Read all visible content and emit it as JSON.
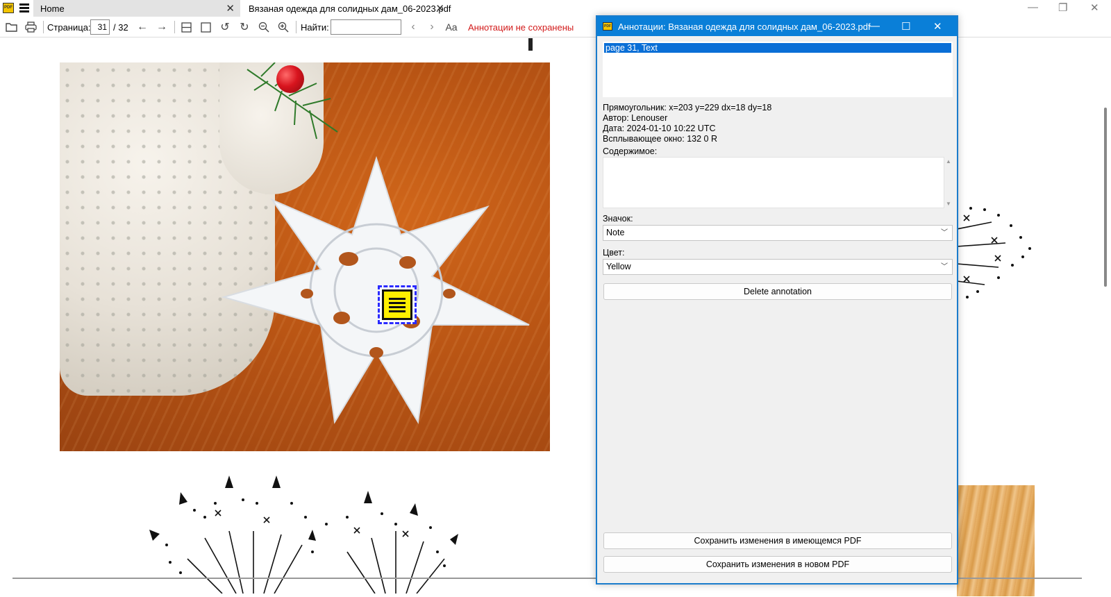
{
  "app": {
    "logo_text": "PDF",
    "tabs": [
      {
        "label": "Home"
      },
      {
        "label": "Вязаная одежда для солидных дам_06-2023.pdf"
      }
    ]
  },
  "toolbar": {
    "page_label": "Страница:",
    "current_page": "31",
    "total_pages": "/ 32",
    "find_label": "Найти:",
    "find_value": "",
    "match_case_label": "Aa",
    "status_unsaved": "Аннотации не сохранены"
  },
  "dialog": {
    "title": "Аннотации: Вязаная одежда для солидных дам_06-2023.pdf",
    "annotation_list": [
      "page 31, Text"
    ],
    "info": {
      "rect": "Прямоугольник: x=203 y=229 dx=18 dy=18",
      "author": "Автор: Lenouser",
      "date": "Дата: 2024-01-10 10:22 UTC",
      "popup": "Всплывающее окно: 132 0 R"
    },
    "content_label": "Содержимое:",
    "content_value": "",
    "icon_label": "Значок:",
    "icon_value": "Note",
    "color_label": "Цвет:",
    "color_value": "Yellow",
    "delete_button": "Delete annotation",
    "save_existing_button": "Сохранить изменения в имеющемся PDF",
    "save_new_button": "Сохранить изменения в новом PDF"
  },
  "colors": {
    "accent": "#0a7fd8",
    "selection": "#0a6fd6",
    "unsaved_status": "#d21a1a",
    "annotation_fill": "#ffef00",
    "annotation_border": "#2a2aff"
  },
  "icons": {
    "open": "folder-icon",
    "print": "printer-icon",
    "prev_page": "arrow-left-icon",
    "next_page": "arrow-right-icon",
    "fit_width": "fit-width-icon",
    "fit_page": "fit-page-icon",
    "rotate_left": "rotate-left-icon",
    "rotate_right": "rotate-right-icon",
    "zoom_out": "zoom-out-icon",
    "zoom_in": "zoom-in-icon",
    "find_prev": "chevron-left-icon",
    "find_next": "chevron-right-icon",
    "annotation": "note-annotation-icon"
  }
}
